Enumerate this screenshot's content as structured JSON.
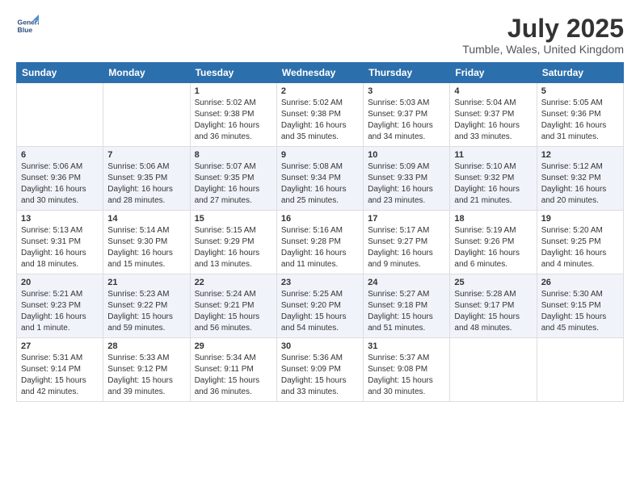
{
  "header": {
    "logo_line1": "General",
    "logo_line2": "Blue",
    "title": "July 2025",
    "location": "Tumble, Wales, United Kingdom"
  },
  "days_of_week": [
    "Sunday",
    "Monday",
    "Tuesday",
    "Wednesday",
    "Thursday",
    "Friday",
    "Saturday"
  ],
  "weeks": [
    [
      {
        "day": "",
        "info": ""
      },
      {
        "day": "",
        "info": ""
      },
      {
        "day": "1",
        "info": "Sunrise: 5:02 AM\nSunset: 9:38 PM\nDaylight: 16 hours\nand 36 minutes."
      },
      {
        "day": "2",
        "info": "Sunrise: 5:02 AM\nSunset: 9:38 PM\nDaylight: 16 hours\nand 35 minutes."
      },
      {
        "day": "3",
        "info": "Sunrise: 5:03 AM\nSunset: 9:37 PM\nDaylight: 16 hours\nand 34 minutes."
      },
      {
        "day": "4",
        "info": "Sunrise: 5:04 AM\nSunset: 9:37 PM\nDaylight: 16 hours\nand 33 minutes."
      },
      {
        "day": "5",
        "info": "Sunrise: 5:05 AM\nSunset: 9:36 PM\nDaylight: 16 hours\nand 31 minutes."
      }
    ],
    [
      {
        "day": "6",
        "info": "Sunrise: 5:06 AM\nSunset: 9:36 PM\nDaylight: 16 hours\nand 30 minutes."
      },
      {
        "day": "7",
        "info": "Sunrise: 5:06 AM\nSunset: 9:35 PM\nDaylight: 16 hours\nand 28 minutes."
      },
      {
        "day": "8",
        "info": "Sunrise: 5:07 AM\nSunset: 9:35 PM\nDaylight: 16 hours\nand 27 minutes."
      },
      {
        "day": "9",
        "info": "Sunrise: 5:08 AM\nSunset: 9:34 PM\nDaylight: 16 hours\nand 25 minutes."
      },
      {
        "day": "10",
        "info": "Sunrise: 5:09 AM\nSunset: 9:33 PM\nDaylight: 16 hours\nand 23 minutes."
      },
      {
        "day": "11",
        "info": "Sunrise: 5:10 AM\nSunset: 9:32 PM\nDaylight: 16 hours\nand 21 minutes."
      },
      {
        "day": "12",
        "info": "Sunrise: 5:12 AM\nSunset: 9:32 PM\nDaylight: 16 hours\nand 20 minutes."
      }
    ],
    [
      {
        "day": "13",
        "info": "Sunrise: 5:13 AM\nSunset: 9:31 PM\nDaylight: 16 hours\nand 18 minutes."
      },
      {
        "day": "14",
        "info": "Sunrise: 5:14 AM\nSunset: 9:30 PM\nDaylight: 16 hours\nand 15 minutes."
      },
      {
        "day": "15",
        "info": "Sunrise: 5:15 AM\nSunset: 9:29 PM\nDaylight: 16 hours\nand 13 minutes."
      },
      {
        "day": "16",
        "info": "Sunrise: 5:16 AM\nSunset: 9:28 PM\nDaylight: 16 hours\nand 11 minutes."
      },
      {
        "day": "17",
        "info": "Sunrise: 5:17 AM\nSunset: 9:27 PM\nDaylight: 16 hours\nand 9 minutes."
      },
      {
        "day": "18",
        "info": "Sunrise: 5:19 AM\nSunset: 9:26 PM\nDaylight: 16 hours\nand 6 minutes."
      },
      {
        "day": "19",
        "info": "Sunrise: 5:20 AM\nSunset: 9:25 PM\nDaylight: 16 hours\nand 4 minutes."
      }
    ],
    [
      {
        "day": "20",
        "info": "Sunrise: 5:21 AM\nSunset: 9:23 PM\nDaylight: 16 hours\nand 1 minute."
      },
      {
        "day": "21",
        "info": "Sunrise: 5:23 AM\nSunset: 9:22 PM\nDaylight: 15 hours\nand 59 minutes."
      },
      {
        "day": "22",
        "info": "Sunrise: 5:24 AM\nSunset: 9:21 PM\nDaylight: 15 hours\nand 56 minutes."
      },
      {
        "day": "23",
        "info": "Sunrise: 5:25 AM\nSunset: 9:20 PM\nDaylight: 15 hours\nand 54 minutes."
      },
      {
        "day": "24",
        "info": "Sunrise: 5:27 AM\nSunset: 9:18 PM\nDaylight: 15 hours\nand 51 minutes."
      },
      {
        "day": "25",
        "info": "Sunrise: 5:28 AM\nSunset: 9:17 PM\nDaylight: 15 hours\nand 48 minutes."
      },
      {
        "day": "26",
        "info": "Sunrise: 5:30 AM\nSunset: 9:15 PM\nDaylight: 15 hours\nand 45 minutes."
      }
    ],
    [
      {
        "day": "27",
        "info": "Sunrise: 5:31 AM\nSunset: 9:14 PM\nDaylight: 15 hours\nand 42 minutes."
      },
      {
        "day": "28",
        "info": "Sunrise: 5:33 AM\nSunset: 9:12 PM\nDaylight: 15 hours\nand 39 minutes."
      },
      {
        "day": "29",
        "info": "Sunrise: 5:34 AM\nSunset: 9:11 PM\nDaylight: 15 hours\nand 36 minutes."
      },
      {
        "day": "30",
        "info": "Sunrise: 5:36 AM\nSunset: 9:09 PM\nDaylight: 15 hours\nand 33 minutes."
      },
      {
        "day": "31",
        "info": "Sunrise: 5:37 AM\nSunset: 9:08 PM\nDaylight: 15 hours\nand 30 minutes."
      },
      {
        "day": "",
        "info": ""
      },
      {
        "day": "",
        "info": ""
      }
    ]
  ]
}
